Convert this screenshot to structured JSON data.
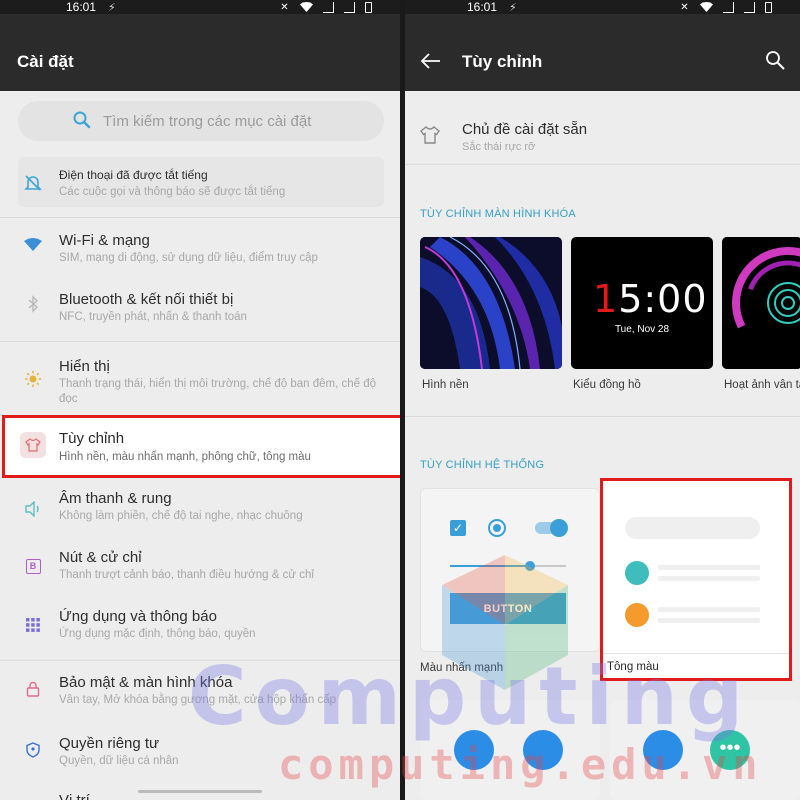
{
  "left": {
    "status": {
      "time": "16:01",
      "vib": "⚡"
    },
    "title": "Cài đặt",
    "search_placeholder": "Tìm kiếm trong các mục cài đặt",
    "items": [
      {
        "title": "Điện thoại đã được tắt tiếng",
        "subtitle": "Các cuộc gọi và thông báo sẽ được tắt tiếng"
      },
      {
        "title": "Wi-Fi & mạng",
        "subtitle": "SIM, mạng di động, sử dụng dữ liệu, điểm truy cập"
      },
      {
        "title": "Bluetooth & kết nối thiết bị",
        "subtitle": "NFC, truyền phát, nhấn & thanh toán"
      },
      {
        "title": "Hiển thị",
        "subtitle": "Thanh trạng thái, hiển thị môi trường, chế độ ban đêm, chế độ đọc"
      },
      {
        "title": "Tùy chỉnh",
        "subtitle": "Hình nền, màu nhấn mạnh, phông chữ, tông màu"
      },
      {
        "title": "Âm thanh & rung",
        "subtitle": "Không làm phiền, chế độ tai nghe, nhạc chuông"
      },
      {
        "title": "Nút & cử chỉ",
        "subtitle": "Thanh trượt cảnh báo, thanh điều hướng & cử chỉ"
      },
      {
        "title": "Ứng dụng và thông báo",
        "subtitle": "Ứng dụng mặc định, thông báo, quyền"
      },
      {
        "title": "Bảo mật & màn hình khóa",
        "subtitle": "Vân tay, Mở khóa bằng gương mặt, cửa hộp khẩn cấp"
      },
      {
        "title": "Quyền riêng tư",
        "subtitle": "Quyền, dữ liệu cá nhân"
      },
      {
        "title": "Vị trí",
        "subtitle": ""
      }
    ]
  },
  "right": {
    "status": {
      "time": "16:01",
      "vib": "⚡"
    },
    "title": "Tùy chỉnh",
    "preset": {
      "title": "Chủ đề cài đặt sẵn",
      "subtitle": "Sắc thái rực rỡ"
    },
    "lock_section": "TÙY CHỈNH MÀN HÌNH KHÓA",
    "lock_items": [
      "Hình nền",
      "Kiểu đồng hồ",
      "Hoạt ảnh vân tay"
    ],
    "clock": {
      "digit": "1",
      "rest": "5:00",
      "date": "Tue, Nov 28"
    },
    "system_section": "TÙY CHỈNH HỆ THỐNG",
    "button_label": "BUTTON",
    "system_items": [
      "Màu nhấn mạnh",
      "Tông màu"
    ]
  },
  "watermark": {
    "big": "Computing",
    "url": "computing.edu.vn"
  },
  "colors": {
    "accent": "#35a0c4",
    "highlight": "#e11b1b",
    "orange": "#f59a2c",
    "teal": "#3fbdbd"
  }
}
